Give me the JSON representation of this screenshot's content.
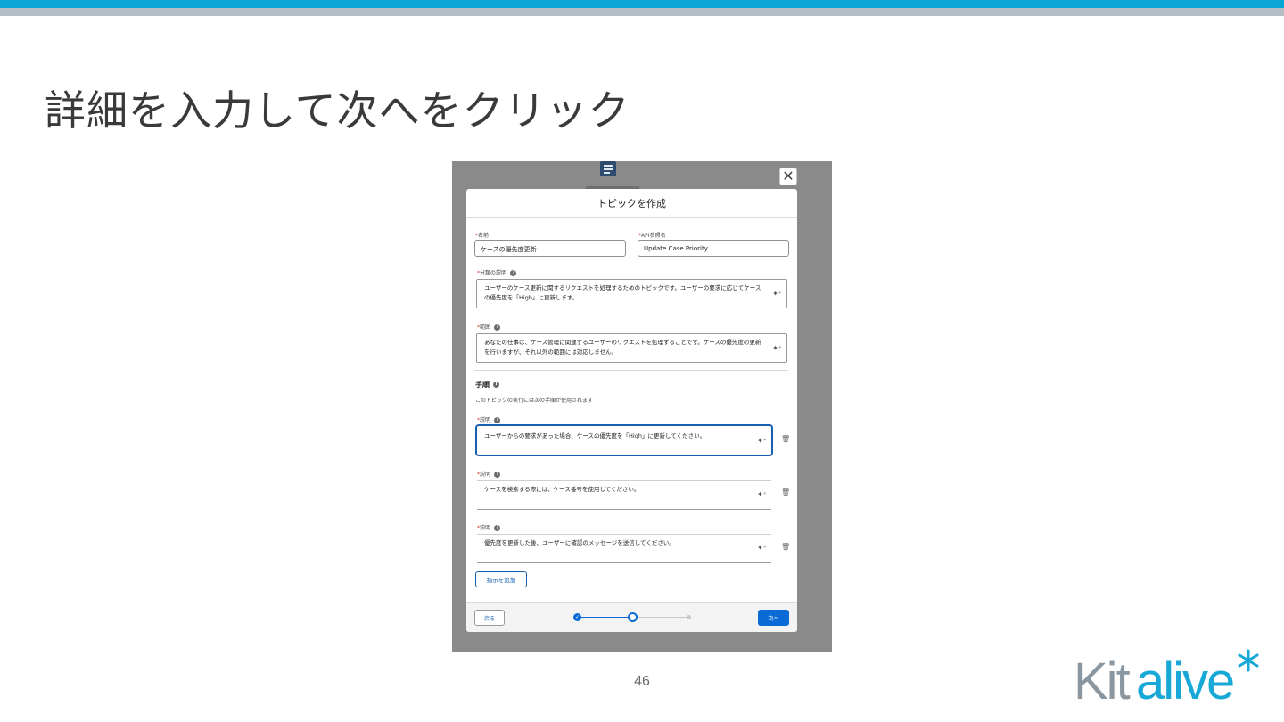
{
  "slide": {
    "title": "詳細を入力して次へをクリック",
    "page_number": "46",
    "logo_text": "Kitalive",
    "colors": {
      "band": "#0aa6d6",
      "sub_band": "#b3bdc4",
      "logo": "#8a96a0",
      "logo_accent": "#18a8d8"
    }
  },
  "modal": {
    "title": "トピックを作成",
    "fields": {
      "name": {
        "label": "名前",
        "value": "ケースの優先度更新"
      },
      "api_name": {
        "label": "API参照名",
        "value": "Update Case Priority"
      },
      "classification": {
        "label": "分類の説明",
        "value": "ユーザーのケース更新に関するリクエストを処理するためのトピックです。ユーザーの要求に応じてケースの優先度を「High」に更新します。"
      },
      "scope": {
        "label": "範囲",
        "value": "あなたの仕事は、ケース管理に関連するユーザーのリクエストを処理することです。ケースの優先度の更新を行いますが、それ以外の範囲には対応しません。"
      }
    },
    "instructions": {
      "title": "手順",
      "helper": "このトピックの実行には次の手順が使用されます",
      "items": [
        {
          "label": "説明",
          "value": "ユーザーからの要求があった場合、ケースの優先度を「High」に更新してください。"
        },
        {
          "label": "説明",
          "value": "ケースを検索する際には、ケース番号を使用してください。"
        },
        {
          "label": "説明",
          "value": "優先度を更新した後、ユーザーに確認のメッセージを送信してください。"
        }
      ],
      "add_label": "指示を追加"
    },
    "footer": {
      "back_label": "戻る",
      "next_label": "次へ"
    },
    "colors": {
      "primary": "#0b6bd6",
      "active_border": "#1b5fb3"
    }
  },
  "icons": {
    "close": "close-icon",
    "info": "info-icon",
    "sparkle": "sparkle-icon",
    "trash": "trash-icon",
    "check": "check-icon"
  }
}
